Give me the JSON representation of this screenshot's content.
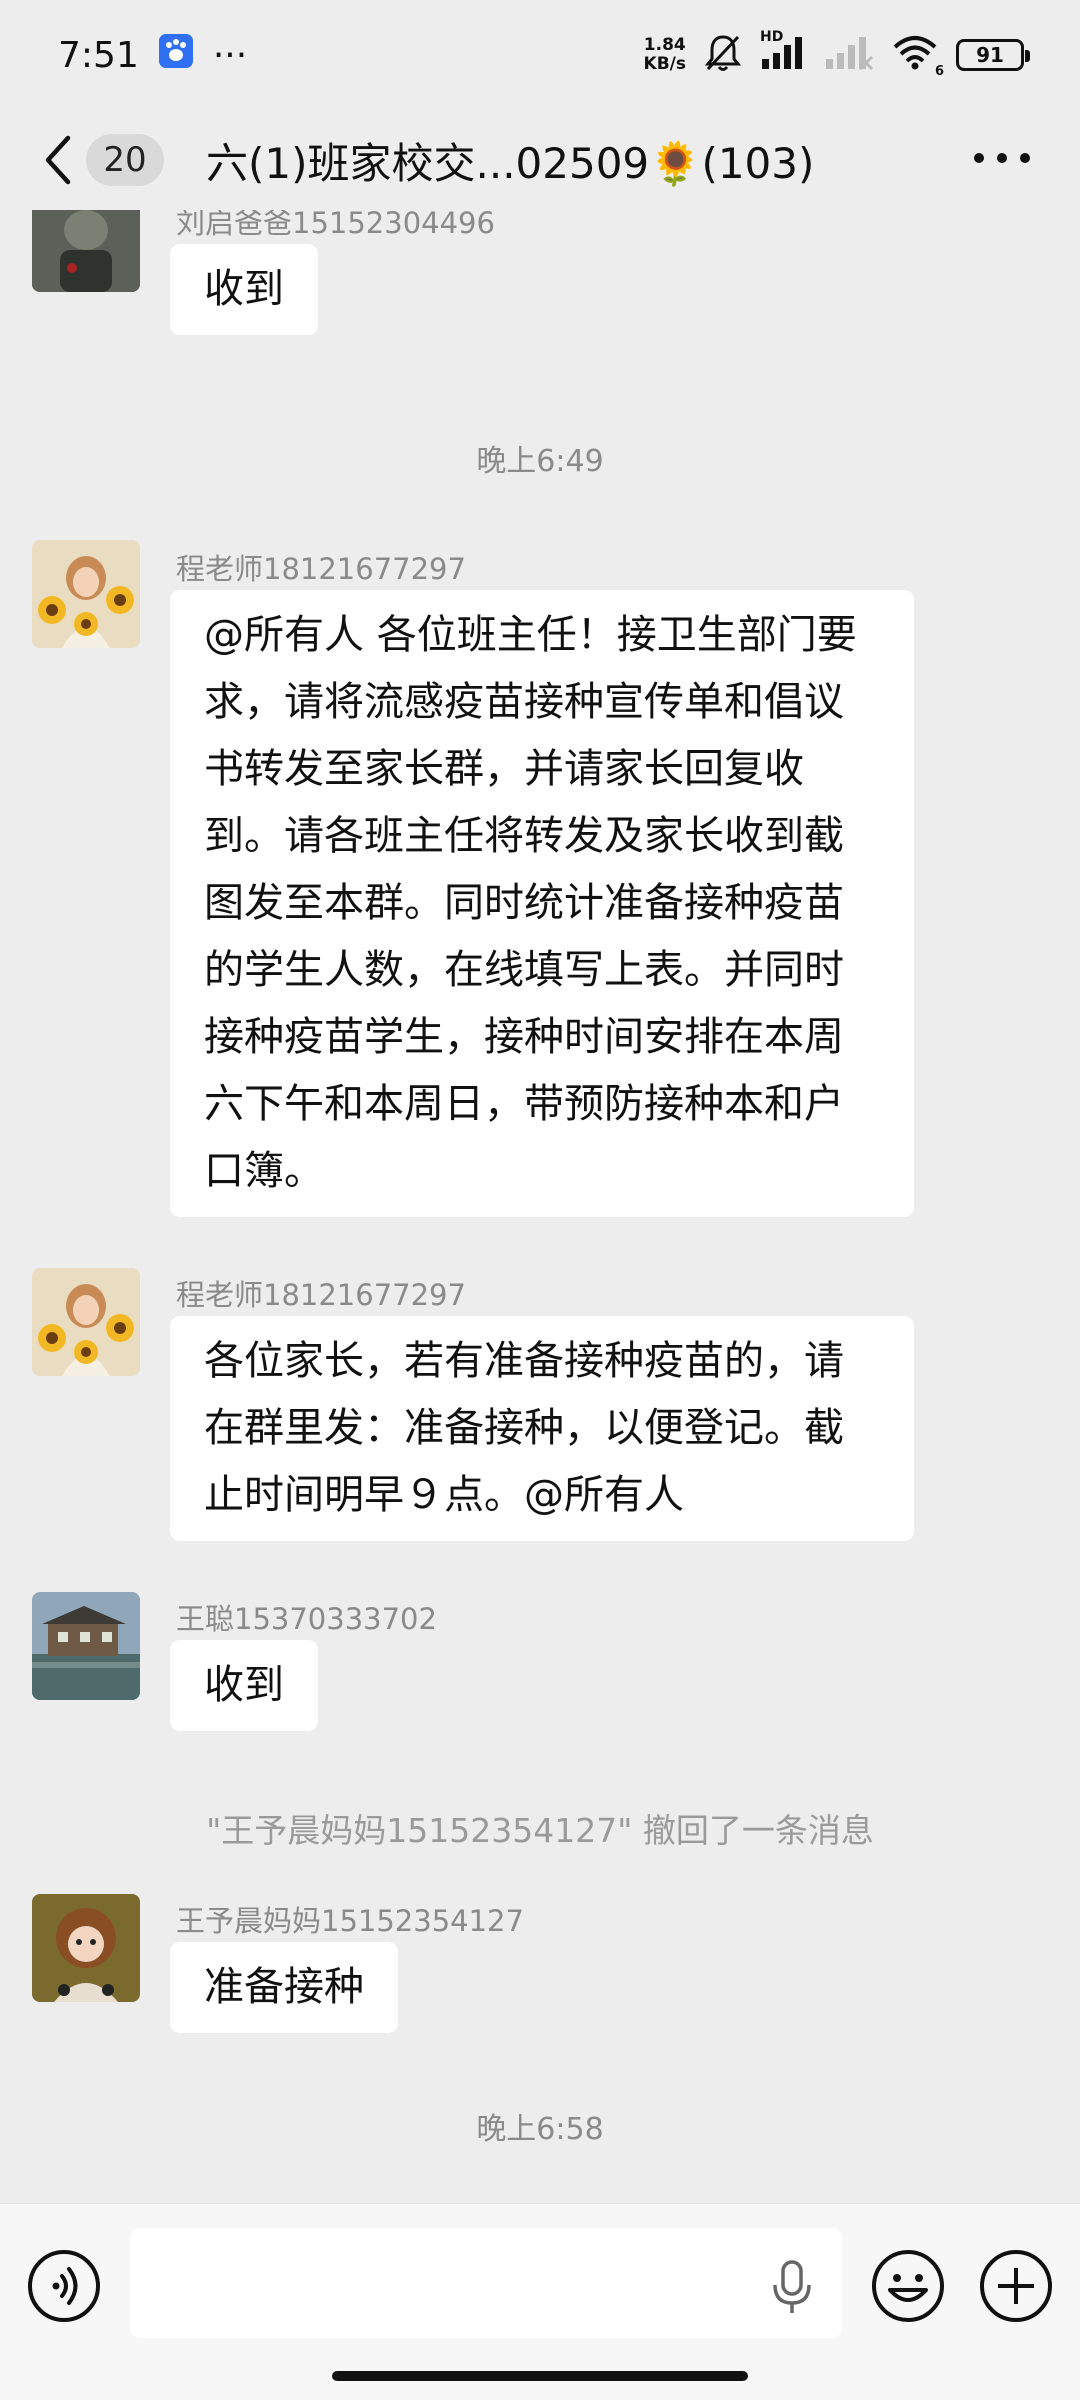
{
  "status_bar": {
    "time": "7:51",
    "more": "···",
    "speed_value": "1.84",
    "speed_unit": "KB/s",
    "network_label": "HD",
    "wifi_label": "6",
    "battery": "91"
  },
  "header": {
    "unread_count": "20",
    "title": "六(1)班家校交...02509🌻(103)"
  },
  "messages": [
    {
      "sender": "刘启爸爸15152304496",
      "text": "收到"
    },
    {
      "time": "晚上6:49"
    },
    {
      "sender": "程老师18121677297",
      "text": "@所有人  各位班主任！接卫生部门要求，请将流感疫苗接种宣传单和倡议书转发至家长群，并请家长回复收到。请各班主任将转发及家长收到截图发至本群。同时统计准备接种疫苗的学生人数，在线填写上表。并同时接种疫苗学生，接种时间安排在本周六下午和本周日，带预防接种本和户口簿。"
    },
    {
      "sender": "程老师18121677297",
      "text": "各位家长，若有准备接种疫苗的，请在群里发：准备接种，以便登记。截止时间明早９点。@所有人"
    },
    {
      "sender": "王聪15370333702",
      "text": "收到"
    },
    {
      "recall": "\"王予晨妈妈15152354127\" 撤回了一条消息"
    },
    {
      "sender": "王予晨妈妈15152354127",
      "text": "准备接种"
    },
    {
      "time": "晚上6:58"
    }
  ],
  "icons": {
    "back": "chevron-left-icon",
    "more": "more-dots-icon",
    "voice": "voice-icon",
    "mic": "microphone-icon",
    "emoji": "emoji-icon",
    "plus": "plus-icon"
  },
  "colors": {
    "background": "#ededed",
    "bubble": "#ffffff",
    "meta_text": "#8a8a8a"
  }
}
